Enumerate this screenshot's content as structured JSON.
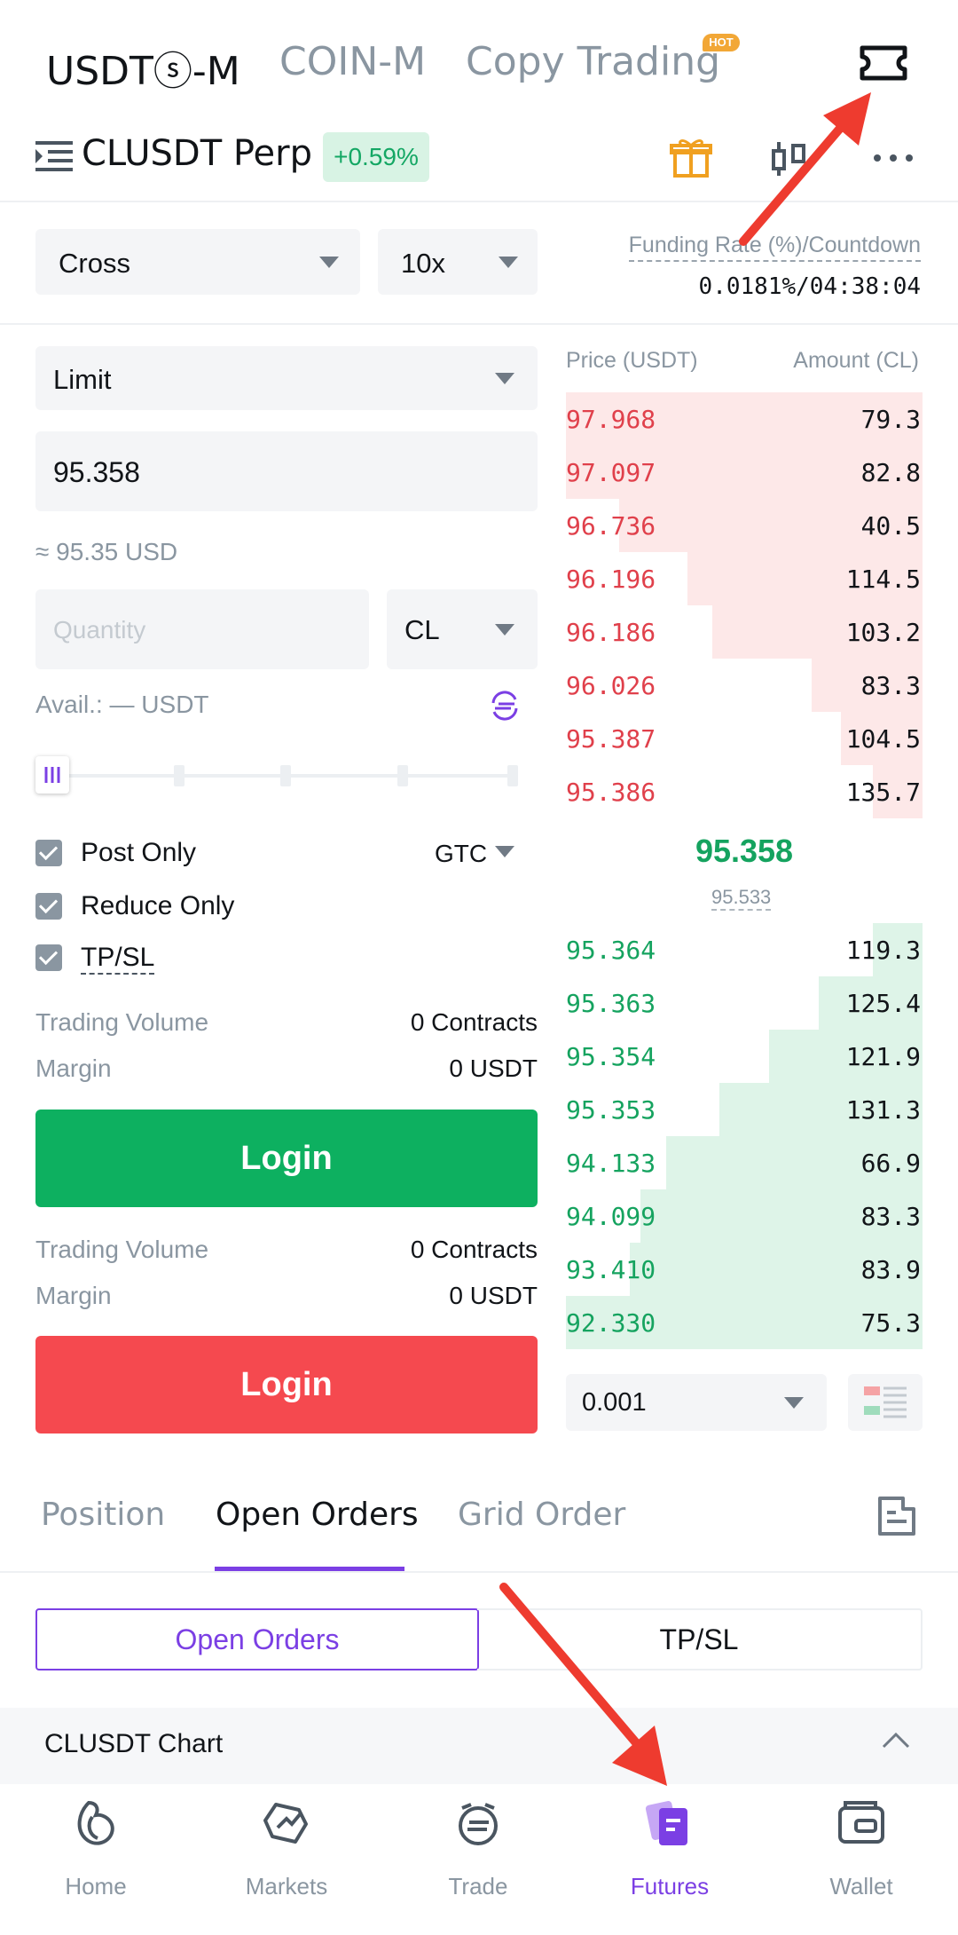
{
  "top_tabs": [
    {
      "label": "USDTⓢ-M",
      "active": true
    },
    {
      "label": "COIN-M",
      "active": false
    },
    {
      "label": "Copy Trading",
      "active": false,
      "badge": "HOT"
    }
  ],
  "symbol": {
    "name": "CLUSDT Perp",
    "change": "+0.59%"
  },
  "margin_mode": "Cross",
  "leverage": "10x",
  "funding": {
    "label": "Funding Rate (%)/Countdown",
    "value": "0.0181%/04:38:04"
  },
  "order_form": {
    "order_type": "Limit",
    "price": "95.358",
    "usd_equiv": "≈ 95.35 USD",
    "quantity_placeholder": "Quantity",
    "quantity_unit": "CL",
    "avail": "Avail.: — USDT",
    "post_only": "Post Only",
    "tif": "GTC",
    "reduce_only": "Reduce Only",
    "tpsl": "TP/SL",
    "buy_block": {
      "volume_label": "Trading Volume",
      "volume_value": "0 Contracts",
      "margin_label": "Margin",
      "margin_value": "0 USDT",
      "button": "Login"
    },
    "sell_block": {
      "volume_label": "Trading Volume",
      "volume_value": "0 Contracts",
      "margin_label": "Margin",
      "margin_value": "0 USDT",
      "button": "Login"
    }
  },
  "orderbook": {
    "price_header": "Price (USDT)",
    "amount_header": "Amount (CL)",
    "asks": [
      {
        "price": "97.968",
        "amount": "79.3",
        "depth": 1.0
      },
      {
        "price": "97.097",
        "amount": "82.8",
        "depth": 1.0
      },
      {
        "price": "96.736",
        "amount": "40.5",
        "depth": 0.85
      },
      {
        "price": "96.196",
        "amount": "114.5",
        "depth": 0.66
      },
      {
        "price": "96.186",
        "amount": "103.2",
        "depth": 0.59
      },
      {
        "price": "96.026",
        "amount": "83.3",
        "depth": 0.31
      },
      {
        "price": "95.387",
        "amount": "104.5",
        "depth": 0.23
      },
      {
        "price": "95.386",
        "amount": "135.7",
        "depth": 0.14
      }
    ],
    "last_price": "95.358",
    "mark_price": "95.533",
    "bids": [
      {
        "price": "95.364",
        "amount": "119.3",
        "depth": 0.14
      },
      {
        "price": "95.363",
        "amount": "125.4",
        "depth": 0.29
      },
      {
        "price": "95.354",
        "amount": "121.9",
        "depth": 0.43
      },
      {
        "price": "95.353",
        "amount": "131.3",
        "depth": 0.57
      },
      {
        "price": "94.133",
        "amount": "66.9",
        "depth": 0.72
      },
      {
        "price": "94.099",
        "amount": "83.3",
        "depth": 0.79
      },
      {
        "price": "93.410",
        "amount": "83.9",
        "depth": 0.82
      },
      {
        "price": "92.330",
        "amount": "75.3",
        "depth": 1.0
      }
    ],
    "precision": "0.001"
  },
  "bottom_tabs": [
    {
      "label": "Position",
      "active": false
    },
    {
      "label": "Open Orders",
      "active": true
    },
    {
      "label": "Grid Order",
      "active": false
    }
  ],
  "sub_tabs": [
    {
      "label": "Open Orders",
      "active": true
    },
    {
      "label": "TP/SL",
      "active": false
    }
  ],
  "chart_bar": {
    "label": "CLUSDT Chart"
  },
  "nav": [
    {
      "label": "Home",
      "icon": "home-icon"
    },
    {
      "label": "Markets",
      "icon": "markets-icon"
    },
    {
      "label": "Trade",
      "icon": "trade-icon"
    },
    {
      "label": "Futures",
      "icon": "futures-icon",
      "active": true
    },
    {
      "label": "Wallet",
      "icon": "wallet-icon"
    }
  ],
  "colors": {
    "accent": "#7b3fe4",
    "buy": "#10b060",
    "sell": "#f5494f",
    "ask_bg": "#fde8e8",
    "bid_bg": "#def4e8"
  }
}
